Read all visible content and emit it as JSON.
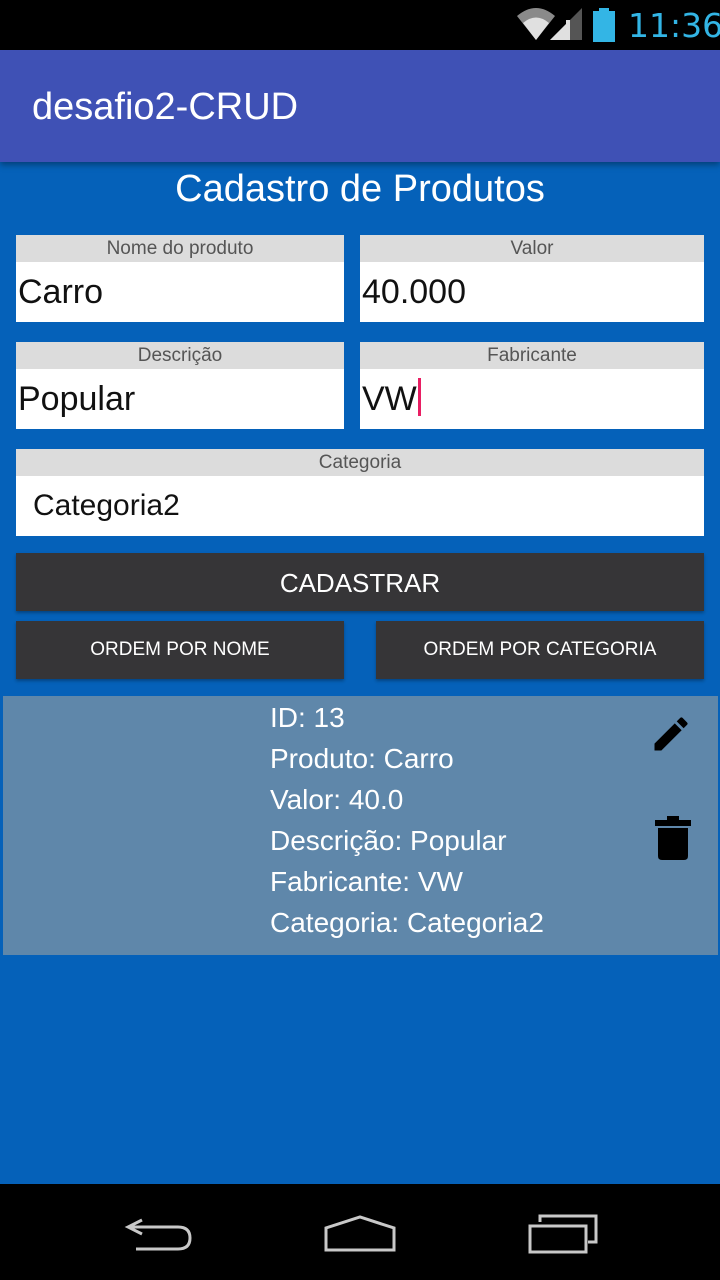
{
  "status_bar": {
    "time": "11:36",
    "icons": [
      "wifi-icon",
      "signal-icon",
      "battery-icon"
    ],
    "accent_color": "#33b5e5"
  },
  "app_bar": {
    "title": "desafio2-CRUD",
    "color": "#3f51b5"
  },
  "page": {
    "title": "Cadastro de Produtos",
    "background": "#0561b9"
  },
  "form": {
    "nome": {
      "label": "Nome do produto",
      "value": "Carro"
    },
    "valor": {
      "label": "Valor",
      "value": "40.000"
    },
    "descricao": {
      "label": "Descrição",
      "value": "Popular"
    },
    "fabricante": {
      "label": "Fabricante",
      "value": "VW"
    },
    "categoria": {
      "label": "Categoria",
      "selected": "Categoria2"
    }
  },
  "buttons": {
    "cadastrar": "CADASTRAR",
    "ordem_nome": "ORDEM POR NOME",
    "ordem_categoria": "ORDEM POR CATEGORIA"
  },
  "products": [
    {
      "id": "ID: 13",
      "produto": "Produto: Carro",
      "valor": "Valor: 40.0",
      "descricao": "Descrição: Popular",
      "fabricante": "Fabricante: VW",
      "categoria": "Categoria: Categoria2",
      "actions": [
        "edit-icon",
        "delete-icon"
      ]
    }
  ],
  "nav_bar": {
    "icons": [
      "back-icon",
      "home-icon",
      "recent-apps-icon"
    ]
  }
}
